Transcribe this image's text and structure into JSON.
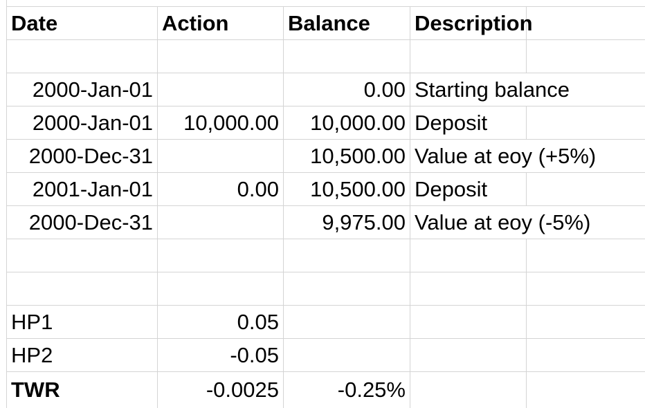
{
  "header": {
    "date": "Date",
    "action": "Action",
    "balance": "Balance",
    "description": "Description"
  },
  "rows": [
    {
      "date": "2000-Jan-01",
      "action": "",
      "balance": "0.00",
      "description": "Starting balance"
    },
    {
      "date": "2000-Jan-01",
      "action": "10,000.00",
      "balance": "10,000.00",
      "description": "Deposit"
    },
    {
      "date": "2000-Dec-31",
      "action": "",
      "balance": "10,500.00",
      "description": "Value at eoy (+5%)"
    },
    {
      "date": "2001-Jan-01",
      "action": "0.00",
      "balance": "10,500.00",
      "description": "Deposit"
    },
    {
      "date": "2000-Dec-31",
      "action": "",
      "balance": "9,975.00",
      "description": "Value at eoy (-5%)"
    }
  ],
  "summary": [
    {
      "label": "HP1",
      "value": "0.05",
      "extra": ""
    },
    {
      "label": "HP2",
      "value": "-0.05",
      "extra": ""
    },
    {
      "label": "TWR",
      "value": "-0.0025",
      "extra": "-0.25%"
    }
  ]
}
